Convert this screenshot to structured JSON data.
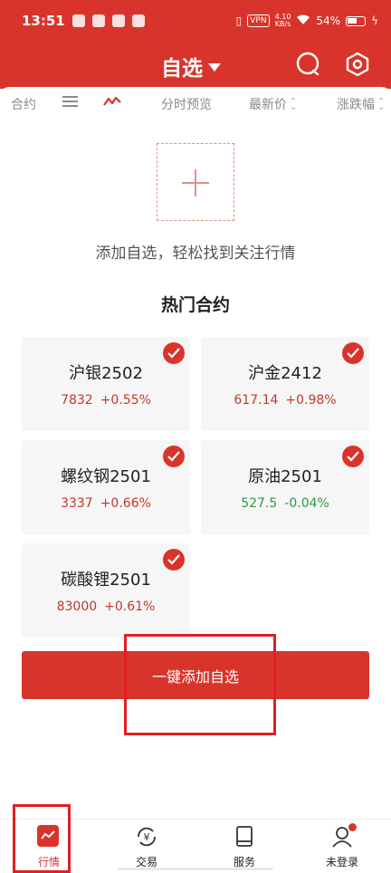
{
  "status_bar": {
    "time": "13:51",
    "vpn": "VPN",
    "speed_value": "4.10",
    "speed_unit": "KB/s",
    "battery": "54%"
  },
  "header": {
    "title": "自选",
    "icons": [
      "search-icon",
      "settings-hexagon-icon"
    ]
  },
  "columns": {
    "contract": "合约",
    "menu_icon": "list-icon",
    "chart_icon": "trend-icon",
    "timeshare": "分时预览",
    "last_price": "最新价",
    "change_pct": "涨跌幅"
  },
  "empty_state": {
    "add_icon": "plus-icon",
    "text": "添加自选，轻松找到关注行情"
  },
  "hot": {
    "title": "热门合约",
    "cards": [
      {
        "name": "沪银2502",
        "price": "7832",
        "change": "+0.55%",
        "direction": "up",
        "checked": true
      },
      {
        "name": "沪金2412",
        "price": "617.14",
        "change": "+0.98%",
        "direction": "up",
        "checked": true
      },
      {
        "name": "螺纹钢2501",
        "price": "3337",
        "change": "+0.66%",
        "direction": "up",
        "checked": true
      },
      {
        "name": "原油2501",
        "price": "527.5",
        "change": "-0.04%",
        "direction": "down",
        "checked": true
      },
      {
        "name": "碳酸锂2501",
        "price": "83000",
        "change": "+0.61%",
        "direction": "up",
        "checked": true
      }
    ]
  },
  "add_all_button": "一键添加自选",
  "colors": {
    "brand_red": "#d9342b",
    "up": "#c0392b",
    "down": "#2e9a45",
    "annotation": "#e01e25"
  },
  "bottom_nav": [
    {
      "label": "行情",
      "icon": "market-icon",
      "active": true
    },
    {
      "label": "交易",
      "icon": "yuan-exchange-icon",
      "active": false
    },
    {
      "label": "服务",
      "icon": "book-icon",
      "active": false
    },
    {
      "label": "未登录",
      "icon": "user-icon",
      "active": false,
      "badge": true
    }
  ]
}
